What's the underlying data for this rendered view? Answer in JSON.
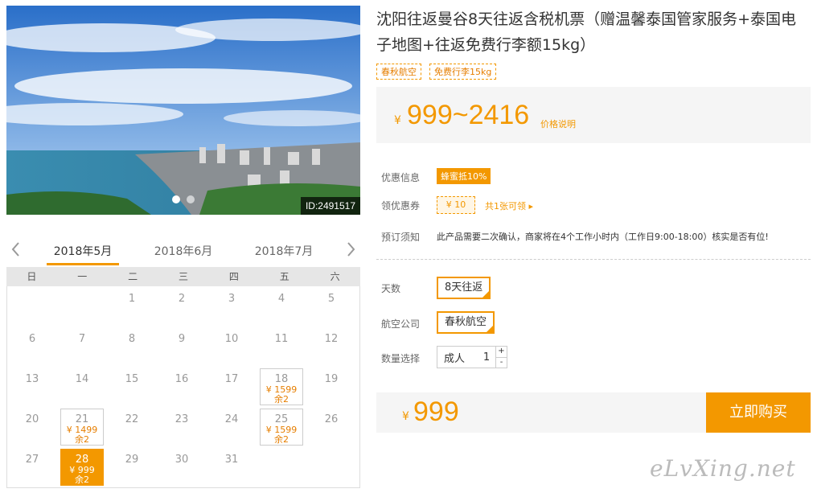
{
  "photo": {
    "id_label": "ID:2491517"
  },
  "calendar": {
    "months": [
      "2018年5月",
      "2018年6月",
      "2018年7月"
    ],
    "weekdays": [
      "日",
      "一",
      "二",
      "三",
      "四",
      "五",
      "六"
    ],
    "days": [
      {
        "d": "",
        "p": "",
        "r": ""
      },
      {
        "d": "",
        "p": "",
        "r": ""
      },
      {
        "d": "1"
      },
      {
        "d": "2"
      },
      {
        "d": "3"
      },
      {
        "d": "4"
      },
      {
        "d": "5"
      },
      {
        "d": "6"
      },
      {
        "d": "7"
      },
      {
        "d": "8"
      },
      {
        "d": "9"
      },
      {
        "d": "10"
      },
      {
        "d": "11"
      },
      {
        "d": "12"
      },
      {
        "d": "13"
      },
      {
        "d": "14"
      },
      {
        "d": "15"
      },
      {
        "d": "16"
      },
      {
        "d": "17"
      },
      {
        "d": "18",
        "p": "¥ 1599",
        "r": "余2"
      },
      {
        "d": "19"
      },
      {
        "d": "20"
      },
      {
        "d": "21",
        "p": "¥ 1499",
        "r": "余2"
      },
      {
        "d": "22"
      },
      {
        "d": "23"
      },
      {
        "d": "24"
      },
      {
        "d": "25",
        "p": "¥ 1599",
        "r": "余2"
      },
      {
        "d": "26"
      },
      {
        "d": "27"
      },
      {
        "d": "28",
        "p": "¥ 999",
        "r": "余2",
        "selected": true
      },
      {
        "d": "29"
      },
      {
        "d": "30"
      },
      {
        "d": "31"
      }
    ]
  },
  "product": {
    "title": "沈阳往返曼谷8天往返含税机票（赠温馨泰国管家服务+泰国电子地图+往返免费行李额15kg）",
    "tags": [
      "春秋航空",
      "免费行李15kg"
    ],
    "currency": "¥",
    "price_range": "999~2416",
    "price_note": "价格说明"
  },
  "info": {
    "promo_label": "优惠信息",
    "promo_badge": "蜂蜜抵10%",
    "coupon_label": "领优惠券",
    "coupon_value": "¥ 10",
    "coupon_link": "共1张可领 ▸",
    "notice_label": "预订须知",
    "notice_text": "此产品需要二次确认，商家将在4个工作小时内（工作日9:00-18:00）核实是否有位!"
  },
  "options": {
    "days_label": "天数",
    "days_value": "8天往返",
    "airline_label": "航空公司",
    "airline_value": "春秋航空",
    "qty_label": "数量选择",
    "qty_type": "成人",
    "qty_value": "1",
    "qty_plus": "+",
    "qty_minus": "-"
  },
  "buy": {
    "currency": "¥",
    "price": "999",
    "button": "立即购买"
  },
  "watermark": "eLvXing.net"
}
